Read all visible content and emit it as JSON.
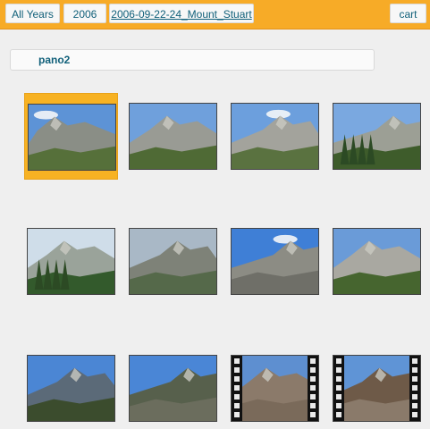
{
  "breadcrumbs": [
    {
      "label": "All Years"
    },
    {
      "label": "2006"
    },
    {
      "label": "2006-09-22-24_Mount_Stuart"
    }
  ],
  "cart_label": "cart",
  "album": {
    "name": "pano2"
  },
  "colors": {
    "accent": "#f7ab27",
    "link": "#11607a",
    "background": "#efefef"
  },
  "thumbnails": [
    {
      "kind": "photo",
      "selected": true
    },
    {
      "kind": "photo",
      "selected": false
    },
    {
      "kind": "photo",
      "selected": false
    },
    {
      "kind": "photo",
      "selected": false
    },
    {
      "kind": "photo",
      "selected": false
    },
    {
      "kind": "photo",
      "selected": false
    },
    {
      "kind": "photo",
      "selected": false
    },
    {
      "kind": "photo",
      "selected": false
    },
    {
      "kind": "photo",
      "selected": false
    },
    {
      "kind": "photo",
      "selected": false
    },
    {
      "kind": "video",
      "selected": false
    },
    {
      "kind": "video",
      "selected": false
    }
  ]
}
